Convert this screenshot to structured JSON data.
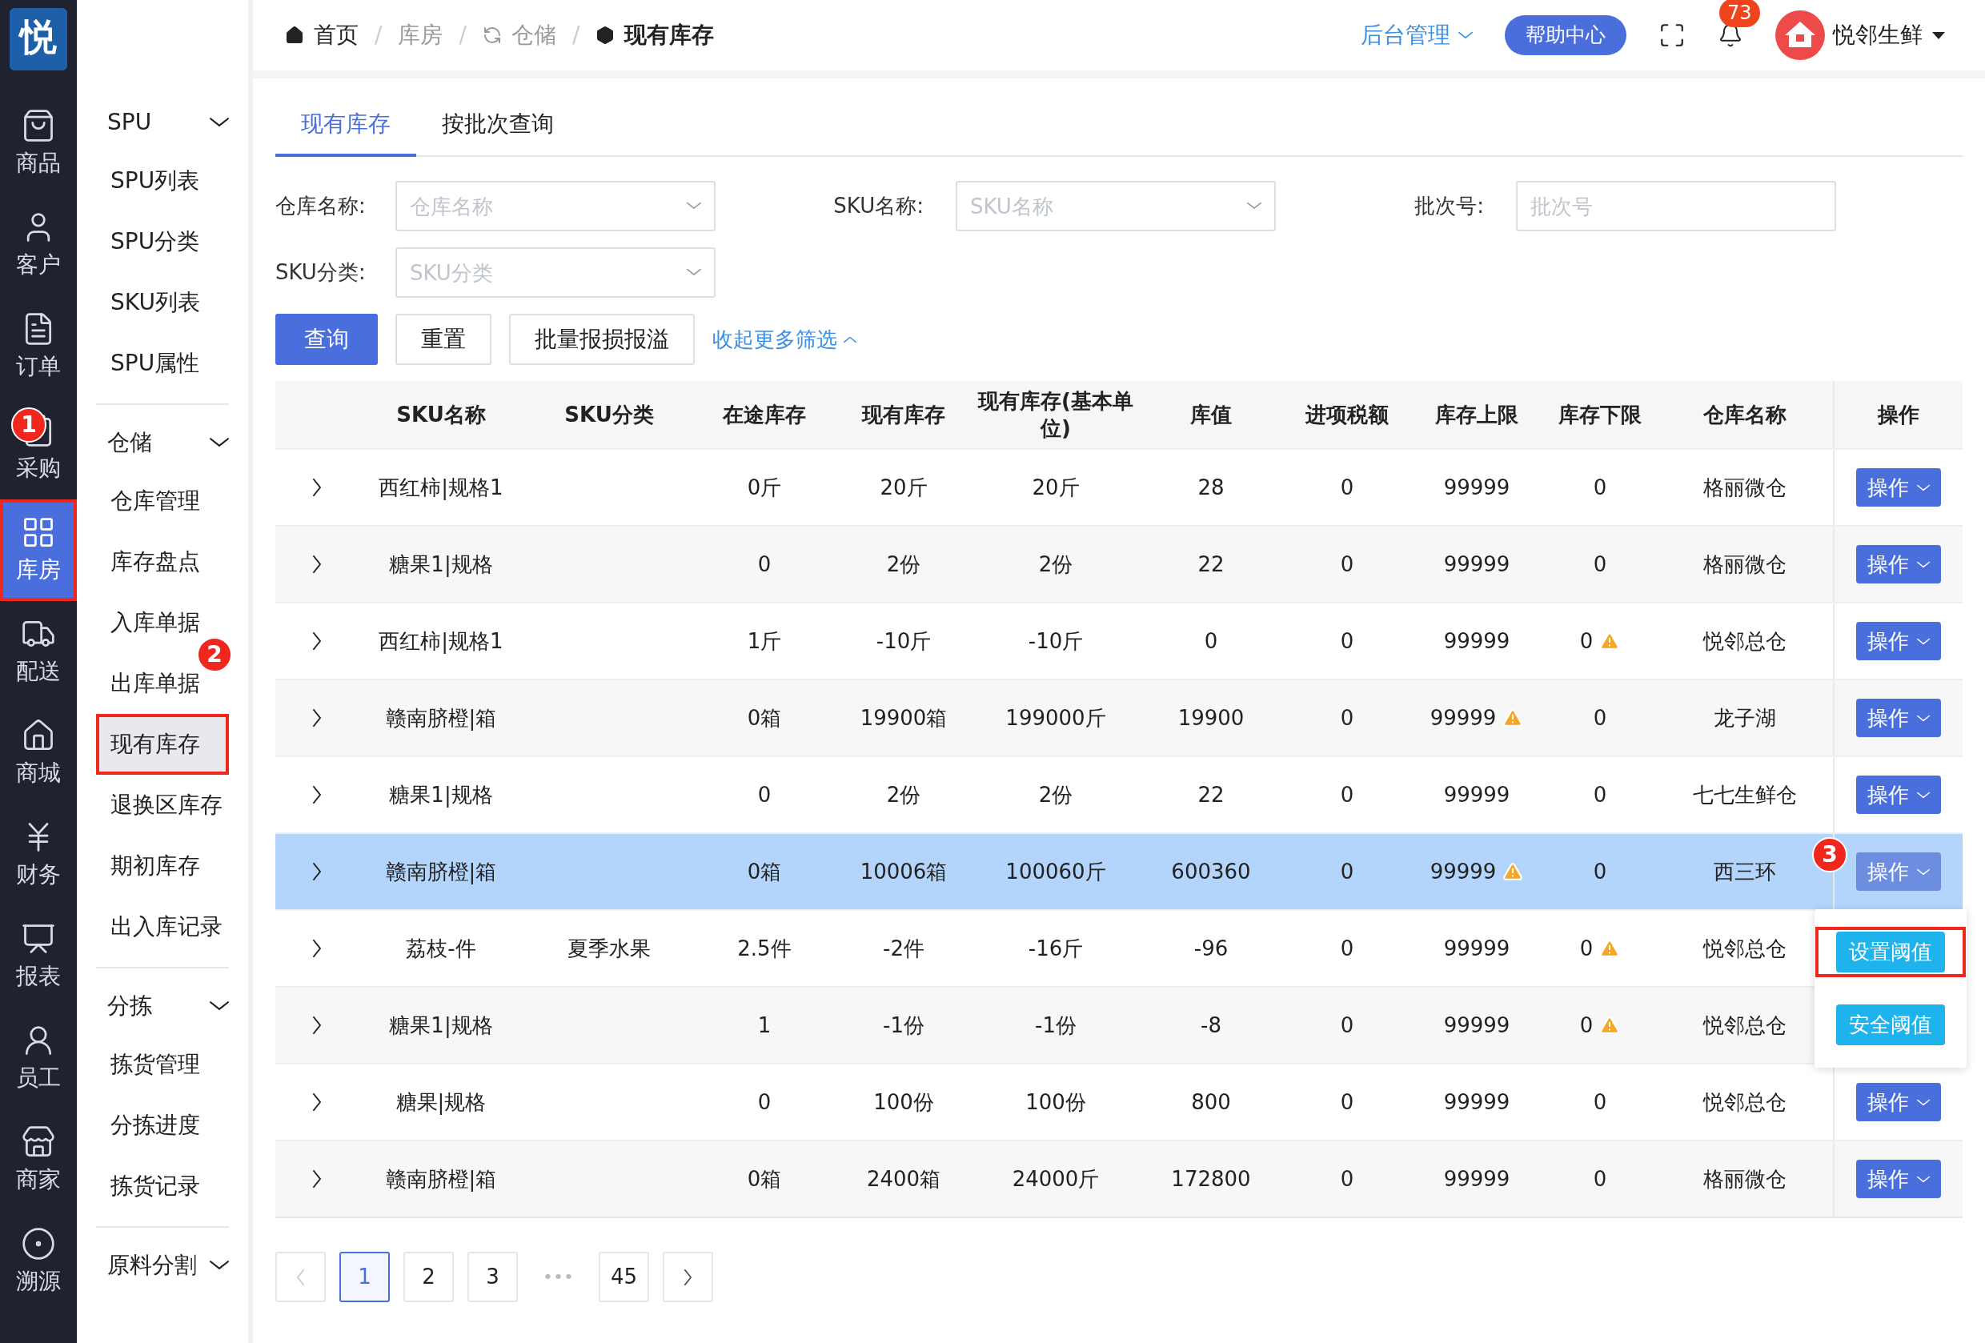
{
  "logo": "悦",
  "nav": [
    {
      "label": "商品",
      "selected": false
    },
    {
      "label": "客户",
      "selected": false
    },
    {
      "label": "订单",
      "selected": false
    },
    {
      "label": "采购",
      "selected": false,
      "marker": "1"
    },
    {
      "label": "库房",
      "selected": true,
      "highlight": true
    },
    {
      "label": "配送",
      "selected": false
    },
    {
      "label": "商城",
      "selected": false
    },
    {
      "label": "财务",
      "selected": false
    },
    {
      "label": "报表",
      "selected": false
    },
    {
      "label": "员工",
      "selected": false
    },
    {
      "label": "商家",
      "selected": false
    },
    {
      "label": "溯源",
      "selected": false
    }
  ],
  "submenu": [
    {
      "label": "SPU",
      "expanded": true,
      "children": [
        {
          "label": "SPU列表",
          "selected": false
        },
        {
          "label": "SPU分类",
          "selected": false
        },
        {
          "label": "SKU列表",
          "selected": false
        },
        {
          "label": "SPU属性",
          "selected": false
        }
      ]
    },
    {
      "label": "仓储",
      "expanded": true,
      "children": [
        {
          "label": "仓库管理",
          "selected": false
        },
        {
          "label": "库存盘点",
          "selected": false
        },
        {
          "label": "入库单据",
          "selected": false
        },
        {
          "label": "出库单据",
          "selected": false,
          "marker": "2"
        },
        {
          "label": "现有库存",
          "selected": true,
          "highlight": true
        },
        {
          "label": "退换区库存",
          "selected": false
        },
        {
          "label": "期初库存",
          "selected": false
        },
        {
          "label": "出入库记录",
          "selected": false
        }
      ]
    },
    {
      "label": "分拣",
      "expanded": true,
      "children": [
        {
          "label": "拣货管理",
          "selected": false
        },
        {
          "label": "分拣进度",
          "selected": false
        },
        {
          "label": "拣货记录",
          "selected": false
        }
      ]
    },
    {
      "label": "原料分割",
      "expanded": true
    }
  ],
  "breadcrumb": [
    "首页",
    "库房",
    "仓储",
    "现有库存"
  ],
  "breadcrumb_separator": "/",
  "header": {
    "admin": "后台管理",
    "help": "帮助中心",
    "notifications": "73",
    "user": "悦邻生鲜"
  },
  "tabs": [
    {
      "label": "现有库存",
      "selected": true
    },
    {
      "label": "按批次查询",
      "selected": false
    }
  ],
  "filters": [
    {
      "label": "仓库名称:",
      "placeholder": "仓库名称",
      "kind": "select"
    },
    {
      "label": "SKU名称:",
      "placeholder": "SKU名称",
      "kind": "select"
    },
    {
      "label": "批次号:",
      "placeholder": "批次号",
      "kind": "input"
    },
    {
      "label": "SKU分类:",
      "placeholder": "SKU分类",
      "kind": "select"
    }
  ],
  "buttons": [
    "查询",
    "重置",
    "批量报损报溢"
  ],
  "collapse_link": "收起更多筛选",
  "table": {
    "columns": [
      "SKU名称",
      "SKU分类",
      "在途库存",
      "现有库存",
      "现有库存(基本单位)",
      "库值",
      "进项税额",
      "库存上限",
      "库存下限",
      "仓库名称",
      "操作"
    ],
    "rows": [
      {
        "cells": [
          "西红柿|规格1",
          "",
          "0斤",
          "20斤",
          "20斤",
          "28",
          "0",
          "99999",
          "0",
          "格丽微仓"
        ],
        "action": "操作",
        "upper_warning": false,
        "lower_warning": false,
        "selected": false
      },
      {
        "cells": [
          "糖果1|规格",
          "",
          "0",
          "2份",
          "2份",
          "22",
          "0",
          "99999",
          "0",
          "格丽微仓"
        ],
        "action": "操作",
        "upper_warning": false,
        "lower_warning": false,
        "selected": false
      },
      {
        "cells": [
          "西红柿|规格1",
          "",
          "1斤",
          "-10斤",
          "-10斤",
          "0",
          "0",
          "99999",
          "0",
          "悦邻总仓"
        ],
        "action": "操作",
        "upper_warning": false,
        "lower_warning": true,
        "selected": false
      },
      {
        "cells": [
          "赣南脐橙|箱",
          "",
          "0箱",
          "19900箱",
          "199000斤",
          "19900",
          "0",
          "99999",
          "0",
          "龙子湖"
        ],
        "action": "操作",
        "upper_warning": true,
        "lower_warning": false,
        "selected": false
      },
      {
        "cells": [
          "糖果1|规格",
          "",
          "0",
          "2份",
          "2份",
          "22",
          "0",
          "99999",
          "0",
          "七七生鲜仓"
        ],
        "action": "操作",
        "upper_warning": false,
        "lower_warning": false,
        "selected": false
      },
      {
        "cells": [
          "赣南脐橙|箱",
          "",
          "0箱",
          "10006箱",
          "100060斤",
          "600360",
          "0",
          "99999",
          "0",
          "西三环"
        ],
        "action": "操作",
        "upper_warning": true,
        "lower_warning": false,
        "selected": true,
        "marker": "3",
        "menu": [
          {
            "label": "设置阈值",
            "highlight": true
          },
          {
            "label": "安全阈值",
            "highlight": false
          }
        ]
      },
      {
        "cells": [
          "荔枝-件",
          "夏季水果",
          "2.5件",
          "-2件",
          "-16斤",
          "-96",
          "0",
          "99999",
          "0",
          "悦邻总仓"
        ],
        "upper_warning": false,
        "lower_warning": true,
        "selected": false
      },
      {
        "cells": [
          "糖果1|规格",
          "",
          "1",
          "-1份",
          "-1份",
          "-8",
          "0",
          "99999",
          "0",
          "悦邻总仓"
        ],
        "upper_warning": false,
        "lower_warning": true,
        "selected": false
      },
      {
        "cells": [
          "糖果|规格",
          "",
          "0",
          "100份",
          "100份",
          "800",
          "0",
          "99999",
          "0",
          "悦邻总仓"
        ],
        "action": "操作",
        "upper_warning": false,
        "lower_warning": false,
        "selected": false
      },
      {
        "cells": [
          "赣南脐橙|箱",
          "",
          "0箱",
          "2400箱",
          "24000斤",
          "172800",
          "0",
          "99999",
          "0",
          "格丽微仓"
        ],
        "action": "操作",
        "upper_warning": false,
        "lower_warning": false,
        "selected": false
      }
    ]
  },
  "pagination": [
    {
      "label": "1",
      "selected": true
    },
    {
      "label": "2",
      "selected": false
    },
    {
      "label": "3",
      "selected": false
    },
    {
      "label": "•••",
      "kind": "ellipsis"
    },
    {
      "label": "45",
      "selected": false
    }
  ]
}
